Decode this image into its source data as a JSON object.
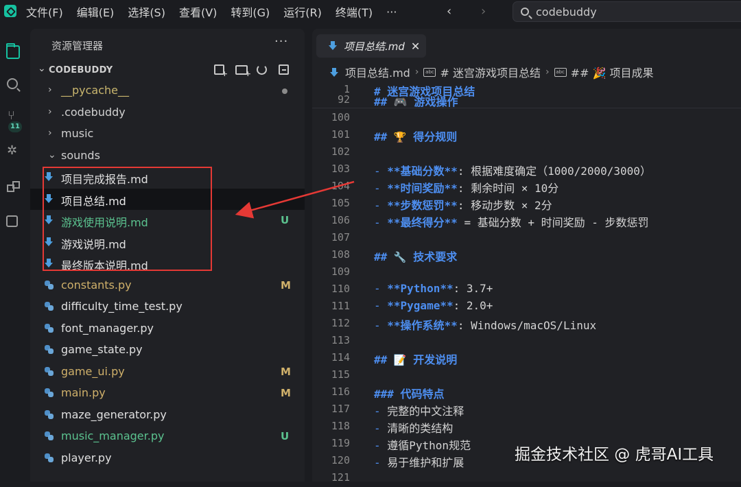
{
  "menubar": {
    "items": [
      "文件(F)",
      "编辑(E)",
      "选择(S)",
      "查看(V)",
      "转到(G)",
      "运行(R)",
      "终端(T)",
      "···"
    ],
    "nav_back": "‹",
    "nav_forward": "›",
    "search_text": "codebuddy"
  },
  "activitybar": {
    "icons": [
      "files-icon",
      "search-icon",
      "source-control-icon",
      "debug-icon",
      "extensions-icon",
      "box-icon"
    ],
    "scm_badge": "11"
  },
  "sidebar": {
    "title": "资源管理器",
    "more": "···",
    "root_label": "CODEBUDDY",
    "items": [
      {
        "label": "__pycache__",
        "type": "folder",
        "expanded": false,
        "color": "#c9b66e",
        "badge": "dot"
      },
      {
        "label": ".codebuddy",
        "type": "folder",
        "expanded": false,
        "color": "#d0d0d0",
        "badge": ""
      },
      {
        "label": "music",
        "type": "folder",
        "expanded": false,
        "color": "#d0d0d0",
        "badge": ""
      },
      {
        "label": "sounds",
        "type": "folder",
        "expanded": true,
        "color": "#d0d0d0",
        "badge": ""
      },
      {
        "label": "项目完成报告.md",
        "type": "md",
        "color": "#e0e0e0",
        "badge": ""
      },
      {
        "label": "项目总结.md",
        "type": "md",
        "color": "#e8e8e8",
        "badge": "",
        "selected": true
      },
      {
        "label": "游戏使用说明.md",
        "type": "md",
        "color": "#5bc28f",
        "badge": "U",
        "badge_color": "#5bc28f"
      },
      {
        "label": "游戏说明.md",
        "type": "md",
        "color": "#e0e0e0",
        "badge": ""
      },
      {
        "label": "最终版本说明.md",
        "type": "md",
        "color": "#e0e0e0",
        "badge": ""
      },
      {
        "label": "constants.py",
        "type": "py",
        "color": "#cfb06a",
        "badge": "M",
        "badge_color": "#cfb06a"
      },
      {
        "label": "difficulty_time_test.py",
        "type": "py",
        "color": "#e0e0e0",
        "badge": ""
      },
      {
        "label": "font_manager.py",
        "type": "py",
        "color": "#e0e0e0",
        "badge": ""
      },
      {
        "label": "game_state.py",
        "type": "py",
        "color": "#e0e0e0",
        "badge": ""
      },
      {
        "label": "game_ui.py",
        "type": "py",
        "color": "#cfb06a",
        "badge": "M",
        "badge_color": "#cfb06a"
      },
      {
        "label": "main.py",
        "type": "py",
        "color": "#cfb06a",
        "badge": "M",
        "badge_color": "#cfb06a"
      },
      {
        "label": "maze_generator.py",
        "type": "py",
        "color": "#e0e0e0",
        "badge": ""
      },
      {
        "label": "music_manager.py",
        "type": "py",
        "color": "#5bc28f",
        "badge": "U",
        "badge_color": "#5bc28f"
      },
      {
        "label": "player.py",
        "type": "py",
        "color": "#e0e0e0",
        "badge": ""
      }
    ]
  },
  "editor": {
    "tab_label": "项目总结.md",
    "tab_close": "✕",
    "breadcrumb": [
      "项目总结.md",
      "# 迷宫游戏项目总结",
      "## 🎉 项目成果"
    ],
    "breadcrumb_abc": "abc",
    "sticky": [
      {
        "ln": "1",
        "text": "# 迷宫游戏项目总结"
      },
      {
        "ln": "92",
        "text": "## 🎮 游戏操作"
      }
    ],
    "lines": [
      {
        "ln": "100",
        "parts": []
      },
      {
        "ln": "101",
        "parts": [
          {
            "c": "heading",
            "t": "## "
          },
          {
            "c": "emoji",
            "t": "🏆"
          },
          {
            "c": "heading",
            "t": " 得分规则"
          }
        ]
      },
      {
        "ln": "102",
        "parts": []
      },
      {
        "ln": "103",
        "parts": [
          {
            "c": "bullet",
            "t": "- "
          },
          {
            "c": "bold-text",
            "t": "**基础分数**"
          },
          {
            "c": "",
            "t": ": 根据难度确定（1000/2000/3000）"
          }
        ]
      },
      {
        "ln": "104",
        "parts": [
          {
            "c": "bullet",
            "t": "- "
          },
          {
            "c": "bold-text",
            "t": "**时间奖励**"
          },
          {
            "c": "",
            "t": ": 剩余时间 × 10分"
          }
        ]
      },
      {
        "ln": "105",
        "parts": [
          {
            "c": "bullet",
            "t": "- "
          },
          {
            "c": "bold-text",
            "t": "**步数惩罚**"
          },
          {
            "c": "",
            "t": ": 移动步数 × 2分"
          }
        ]
      },
      {
        "ln": "106",
        "parts": [
          {
            "c": "bullet",
            "t": "- "
          },
          {
            "c": "bold-text",
            "t": "**最终得分**"
          },
          {
            "c": "",
            "t": " = 基础分数 + 时间奖励 - 步数惩罚"
          }
        ]
      },
      {
        "ln": "107",
        "parts": []
      },
      {
        "ln": "108",
        "parts": [
          {
            "c": "heading",
            "t": "## "
          },
          {
            "c": "emoji",
            "t": "🔧"
          },
          {
            "c": "heading",
            "t": " 技术要求"
          }
        ]
      },
      {
        "ln": "109",
        "parts": []
      },
      {
        "ln": "110",
        "parts": [
          {
            "c": "bullet",
            "t": "- "
          },
          {
            "c": "bold-text",
            "t": "**Python**"
          },
          {
            "c": "",
            "t": ": 3.7+"
          }
        ]
      },
      {
        "ln": "111",
        "parts": [
          {
            "c": "bullet",
            "t": "- "
          },
          {
            "c": "bold-text",
            "t": "**Pygame**"
          },
          {
            "c": "",
            "t": ": 2.0+"
          }
        ]
      },
      {
        "ln": "112",
        "parts": [
          {
            "c": "bullet",
            "t": "- "
          },
          {
            "c": "bold-text",
            "t": "**操作系统**"
          },
          {
            "c": "",
            "t": ": Windows/macOS/Linux"
          }
        ]
      },
      {
        "ln": "113",
        "parts": []
      },
      {
        "ln": "114",
        "parts": [
          {
            "c": "heading",
            "t": "## "
          },
          {
            "c": "emoji",
            "t": "📝"
          },
          {
            "c": "heading",
            "t": " 开发说明"
          }
        ]
      },
      {
        "ln": "115",
        "parts": []
      },
      {
        "ln": "116",
        "parts": [
          {
            "c": "heading",
            "t": "### 代码特点"
          }
        ]
      },
      {
        "ln": "117",
        "parts": [
          {
            "c": "bullet",
            "t": "- "
          },
          {
            "c": "",
            "t": "完整的中文注释"
          }
        ]
      },
      {
        "ln": "118",
        "parts": [
          {
            "c": "bullet",
            "t": "- "
          },
          {
            "c": "",
            "t": "清晰的类结构"
          }
        ]
      },
      {
        "ln": "119",
        "parts": [
          {
            "c": "bullet",
            "t": "- "
          },
          {
            "c": "",
            "t": "遵循Python规范"
          }
        ]
      },
      {
        "ln": "120",
        "parts": [
          {
            "c": "bullet",
            "t": "- "
          },
          {
            "c": "",
            "t": "易于维护和扩展"
          }
        ]
      },
      {
        "ln": "121",
        "parts": []
      }
    ]
  },
  "watermark": "掘金技术社区 @ 虎哥AI工具",
  "colors": {
    "accent": "#16c1a0",
    "annotation": "#e53935",
    "markdown_blue": "#4d8ef0"
  }
}
